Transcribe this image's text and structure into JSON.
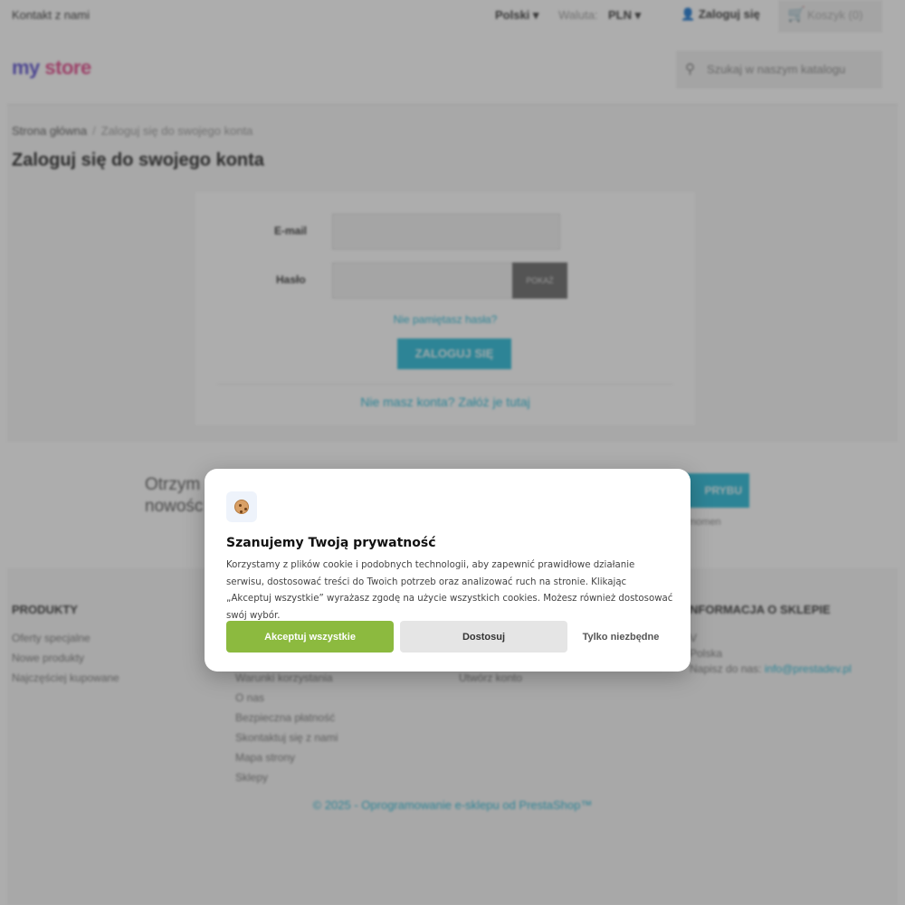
{
  "topbar": {
    "contact": "Kontakt z nami",
    "language": "Polski ▾",
    "currency_label": "Waluta:",
    "currency": "PLN ▾",
    "login": "Zaloguj się",
    "cart": "Koszyk (0)"
  },
  "header": {
    "logo_parts": [
      "my",
      " ",
      "store"
    ],
    "search_placeholder": "Szukaj w naszym katalogu"
  },
  "breadcrumb": {
    "home": "Strona główna",
    "separator": "/",
    "current": "Zaloguj się do swojego konta"
  },
  "page_title": "Zaloguj się do swojego konta",
  "login_form": {
    "email_label": "E-mail",
    "password_label": "Hasło",
    "show_button": "POKAŻ",
    "forgot_link": "Nie pamiętasz hasła?",
    "submit": "ZALOGUJ SIĘ",
    "create_account": "Nie masz konta? Załóż je tutaj"
  },
  "newsletter": {
    "title_line1": "Otrzym",
    "title_line2": "nowośc",
    "button": "PRYBU",
    "note": "momen"
  },
  "footer": {
    "products_heading": "PRODUKTY",
    "products_links": [
      "Oferty specjalne",
      "Nowe produkty",
      "Najczęściej kupowane"
    ],
    "company_links": [
      "Warunki korzystania",
      "O nas",
      "Bezpieczna płatność",
      "Skontaktuj się z nami",
      "Mapa strony",
      "Sklepy"
    ],
    "account_links": [
      "Utwórz konto"
    ],
    "store_heading": "NFORMACJA O SKLEPIE",
    "store_lines": [
      "V",
      "Polska"
    ],
    "store_email_label": "Napisz do nas:",
    "store_email": "info@prestadev.pl",
    "copyright": "© 2025 - Oprogramowanie e-sklepu od PrestaShop™"
  },
  "cookie_modal": {
    "icon": "cookie-icon",
    "title": "Szanujemy Twoją prywatność",
    "text": "Korzystamy z plików cookie i podobnych technologii, aby zapewnić prawidłowe działanie serwisu, dostosować treści do Twoich potrzeb oraz analizować ruch na stronie. Klikając „Akceptuj wszystkie” wyrażasz zgodę na użycie wszystkich cookies. Możesz również dostosować swój wybór.",
    "accept_all": "Akceptuj wszystkie",
    "customize": "Dostosuj",
    "necessary_only": "Tylko niezbędne"
  },
  "colors": {
    "accent": "#24b9d7",
    "accept": "#8cba3f"
  }
}
